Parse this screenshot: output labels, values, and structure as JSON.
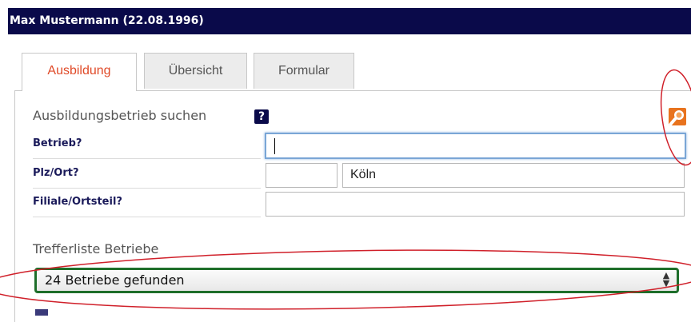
{
  "header": {
    "title": "Max Mustermann (22.08.1996)"
  },
  "tabs": [
    {
      "label": "Ausbildung",
      "active": true
    },
    {
      "label": "Übersicht",
      "active": false
    },
    {
      "label": "Formular",
      "active": false
    }
  ],
  "search": {
    "heading": "Ausbildungsbetrieb suchen",
    "help_icon_label": "?",
    "fields": {
      "betrieb": {
        "label": "Betrieb?",
        "value": ""
      },
      "plz_ort": {
        "label": "Plz/Ort?",
        "plz_value": "",
        "ort_value": "Köln"
      },
      "filiale": {
        "label": "Filiale/Ortsteil?",
        "value": ""
      }
    }
  },
  "results": {
    "label": "Trefferliste Betriebe",
    "selected": "24 Betriebe gefunden"
  },
  "colors": {
    "header_bg": "#0a0a4a",
    "active_tab_text": "#e04a28",
    "annotation_red": "#d0202a",
    "annotation_green": "#1e6e2a",
    "search_icon_bg": "#e8731e"
  }
}
